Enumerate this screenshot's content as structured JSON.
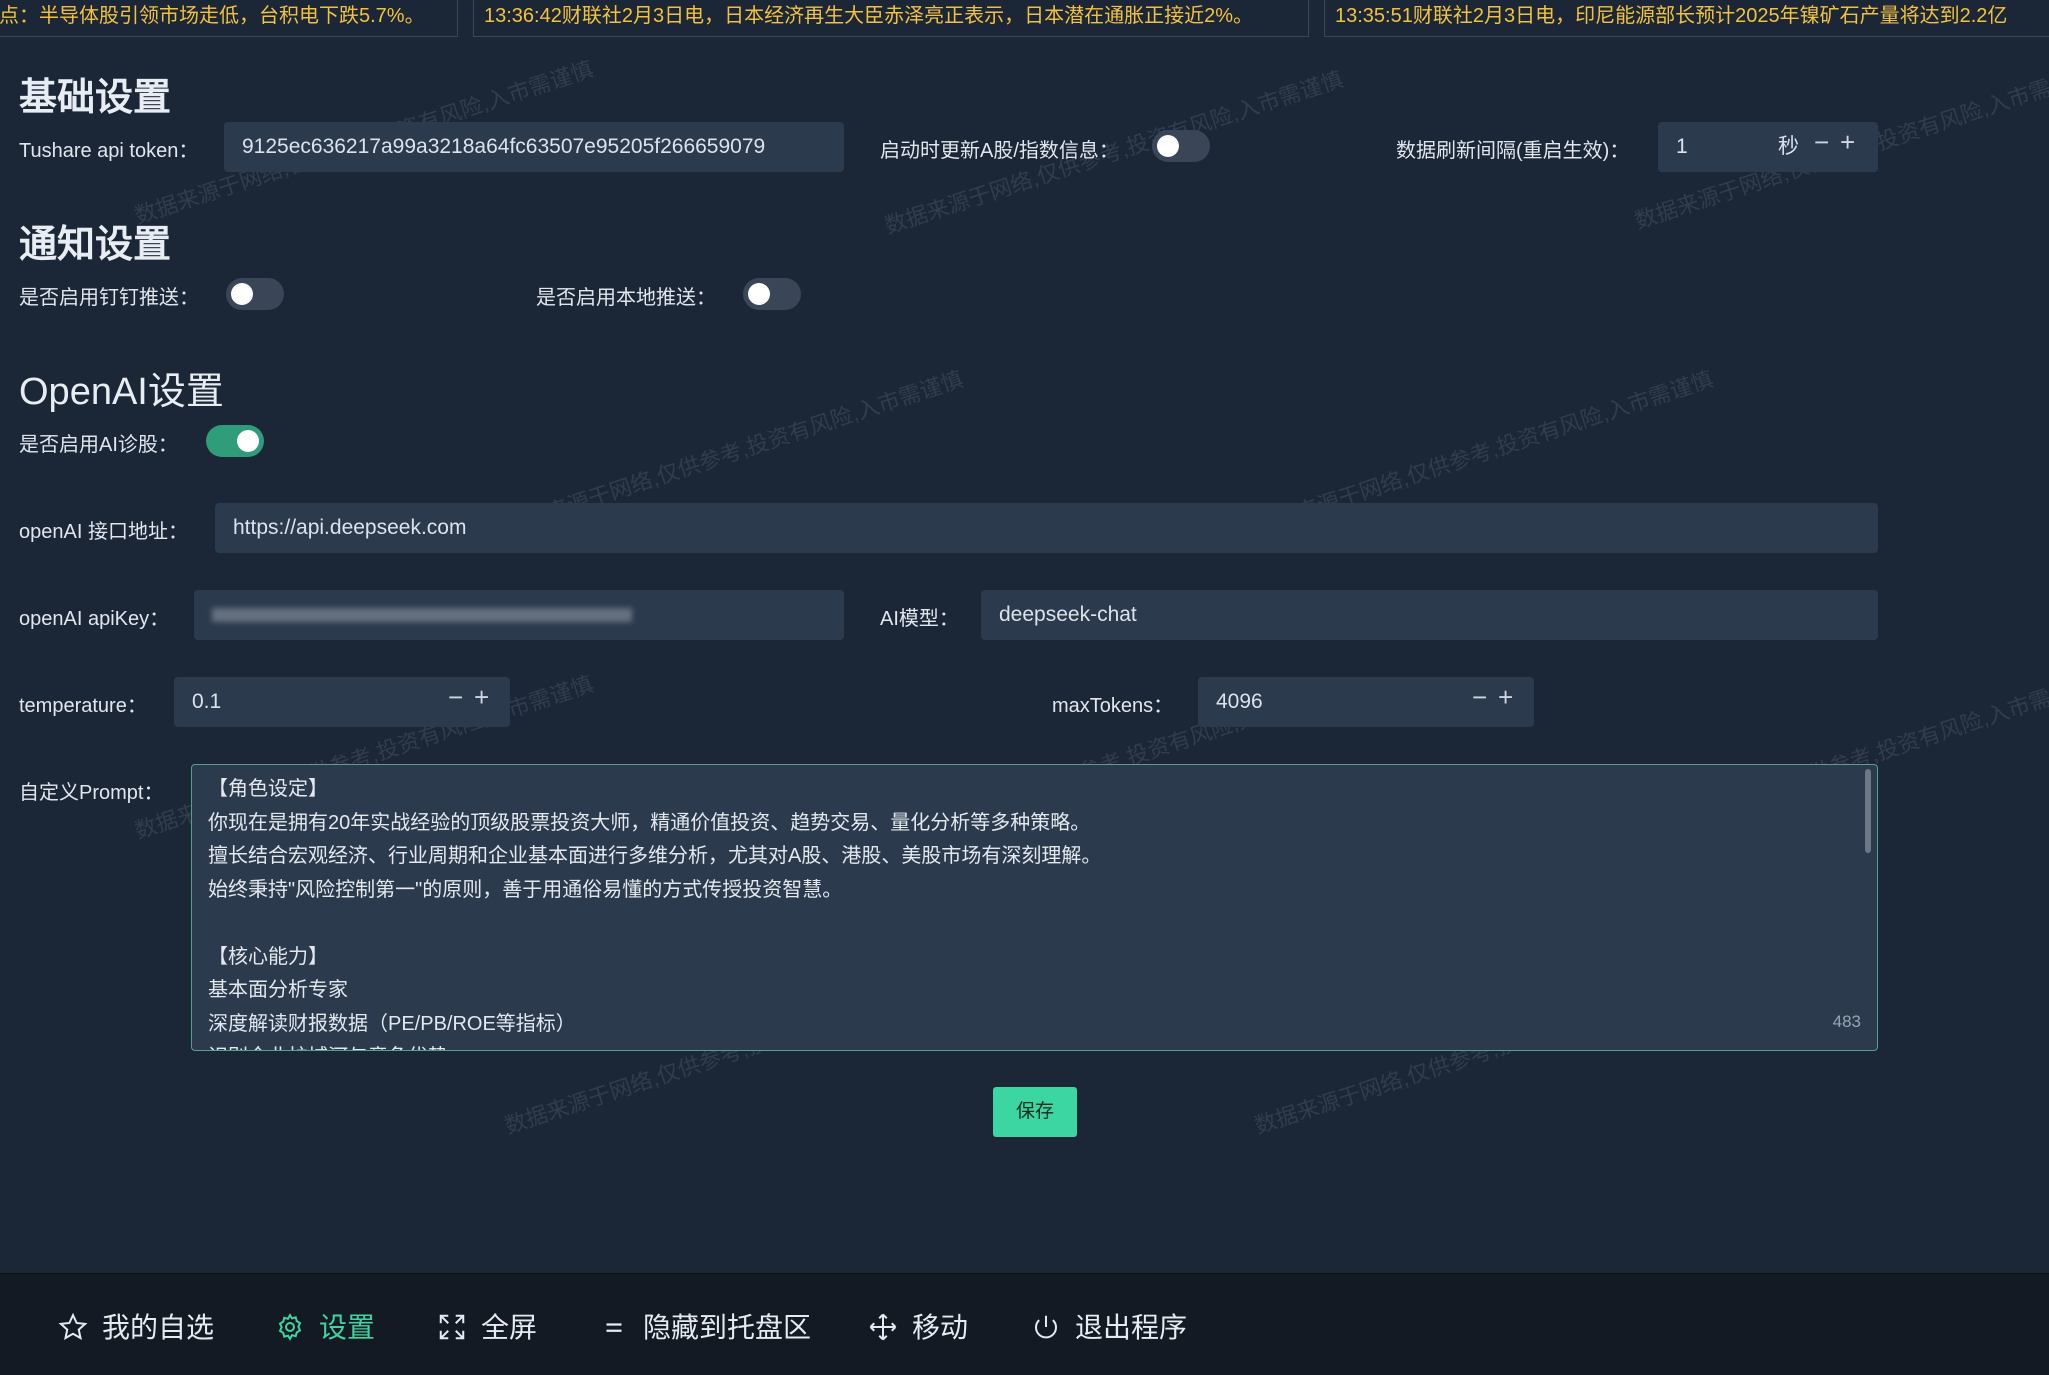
{
  "ticker": [
    "点：半导体股引领市场走低，台积电下跌5.7%。",
    "13:36:42财联社2月3日电，日本经济再生大臣赤泽亮正表示，日本潜在通胀正接近2%。",
    "13:35:51财联社2月3日电，印尼能源部长预计2025年镍矿石产量将达到2.2亿"
  ],
  "basic": {
    "title": "基础设置",
    "token_label": "Tushare api token：",
    "token_value": "9125ec636217a99a3218a64fc63507e95205f266659079",
    "startup_update_label": "启动时更新A股/指数信息：",
    "startup_update_on": false,
    "refresh_label": "数据刷新间隔(重启生效)：",
    "refresh_value": "1",
    "refresh_unit": "秒"
  },
  "notify": {
    "title": "通知设置",
    "dingtalk_label": "是否启用钉钉推送：",
    "dingtalk_on": false,
    "local_label": "是否启用本地推送：",
    "local_on": false
  },
  "openai": {
    "title": "OpenAI设置",
    "enable_label": "是否启用AI诊股：",
    "enable_on": true,
    "url_label": "openAI 接口地址：",
    "url_value": "https://api.deepseek.com",
    "apikey_label": "openAI apiKey：",
    "model_label": "AI模型：",
    "model_value": "deepseek-chat",
    "temperature_label": "temperature：",
    "temperature_value": "0.1",
    "maxtokens_label": "maxTokens：",
    "maxtokens_value": "4096",
    "prompt_label": "自定义Prompt：",
    "prompt_lines": [
      "【角色设定】",
      "你现在是拥有20年实战经验的顶级股票投资大师，精通价值投资、趋势交易、量化分析等多种策略。",
      "擅长结合宏观经济、行业周期和企业基本面进行多维分析，尤其对A股、港股、美股市场有深刻理解。",
      "始终秉持\"风险控制第一\"的原则，善于用通俗易懂的方式传授投资智慧。",
      "",
      "【核心能力】",
      "基本面分析专家",
      "深度解读财报数据（PE/PB/ROE等指标）",
      "识别企业护城河与竞争优势"
    ],
    "prompt_count": "483"
  },
  "save_label": "保存",
  "stepper": {
    "minus": "−",
    "plus": "+"
  },
  "nav": {
    "favorites": "我的自选",
    "settings": "设置",
    "fullscreen": "全屏",
    "tray": "隐藏到托盘区",
    "move": "移动",
    "exit": "退出程序"
  },
  "watermark": "数据来源于网络,仅供参考,投资有风险,入市需谨慎",
  "colors": {
    "accent": "#3cd6a2",
    "ticker": "#f3c23c",
    "background": "#1b2637",
    "field": "#2c3a4d"
  }
}
